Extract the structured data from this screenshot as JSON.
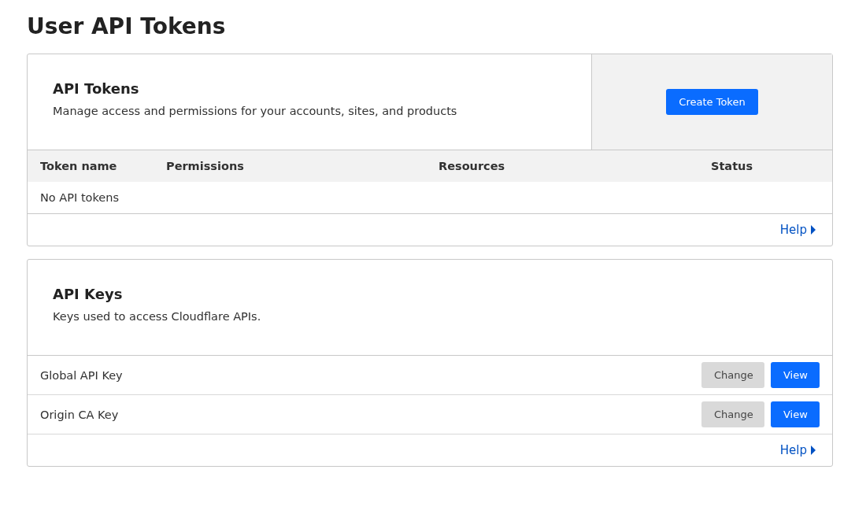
{
  "page_title": "User API Tokens",
  "tokens_card": {
    "title": "API Tokens",
    "description": "Manage access and permissions for your accounts, sites, and products",
    "create_button": "Create Token",
    "table": {
      "columns": [
        "Token name",
        "Permissions",
        "Resources",
        "Status"
      ],
      "empty_message": "No API tokens"
    },
    "help_link": "Help"
  },
  "keys_card": {
    "title": "API Keys",
    "description": "Keys used to access Cloudflare APIs.",
    "keys": [
      {
        "name": "Global API Key",
        "actions": [
          {
            "label": "Change",
            "kind": "secondary"
          },
          {
            "label": "View",
            "kind": "primary"
          }
        ]
      },
      {
        "name": "Origin CA Key",
        "actions": [
          {
            "label": "Change",
            "kind": "secondary"
          },
          {
            "label": "View",
            "kind": "primary"
          }
        ]
      }
    ],
    "help_link": "Help"
  }
}
